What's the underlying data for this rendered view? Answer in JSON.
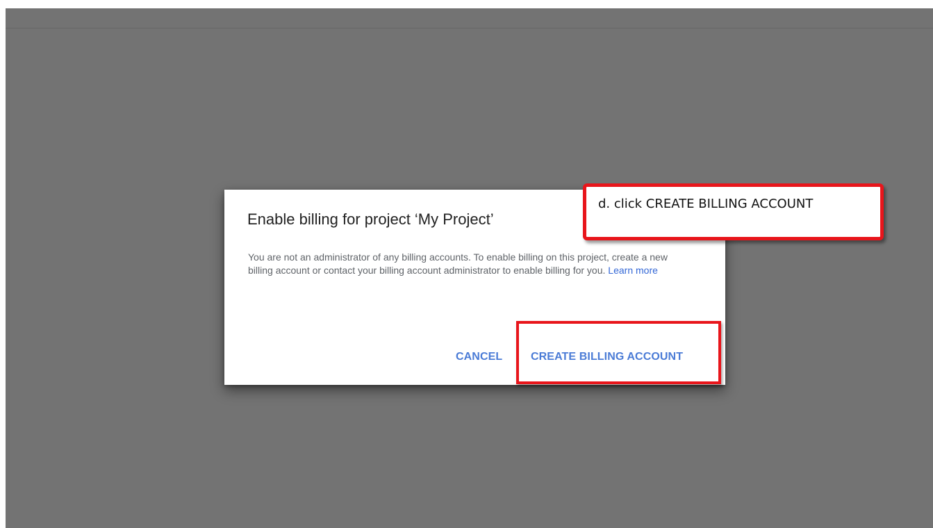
{
  "dialog": {
    "title": "Enable billing for project ‘My Project’",
    "body_text": "You are not an administrator of any billing accounts. To enable billing on this project, create a new billing account or contact your billing account administrator to enable billing for you.",
    "learn_more_label": "Learn more",
    "cancel_label": "CANCEL",
    "create_label": "CREATE BILLING ACCOUNT"
  },
  "annotation": {
    "callout_text": "d. click CREATE BILLING ACCOUNT"
  },
  "colors": {
    "overlay": "#737373",
    "button_text": "#4a7bd6",
    "link": "#3367d6",
    "annotation_red": "#e8151b"
  }
}
